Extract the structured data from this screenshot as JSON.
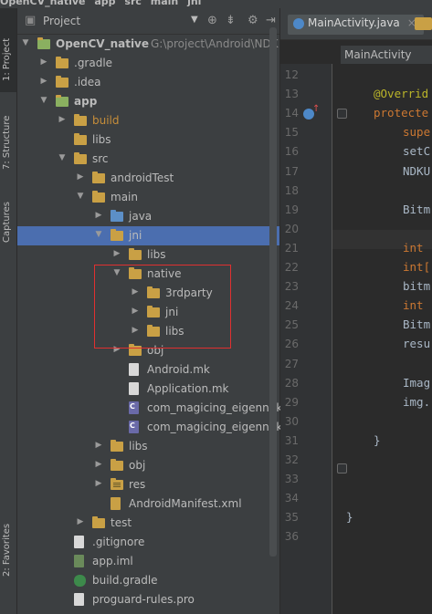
{
  "breadcrumb": [
    "OpenCV_native",
    "app",
    "src",
    "main",
    "jni"
  ],
  "side_tabs": [
    "1: Project",
    "7: Structure",
    "Captures",
    "2: Favorites"
  ],
  "project_panel": {
    "title": "Project",
    "tree": [
      {
        "label": "OpenCV_native",
        "path": "G:\\project\\Android\\NDK",
        "depth": 0,
        "expanded": true,
        "icon": "module",
        "bold": true
      },
      {
        "label": ".gradle",
        "depth": 1,
        "expanded": false,
        "icon": "folder"
      },
      {
        "label": ".idea",
        "depth": 1,
        "expanded": false,
        "icon": "folder"
      },
      {
        "label": "app",
        "depth": 1,
        "expanded": true,
        "icon": "module",
        "bold": true
      },
      {
        "label": "build",
        "depth": 2,
        "expanded": false,
        "icon": "folder"
      },
      {
        "label": "libs",
        "depth": 2,
        "icon": "folder"
      },
      {
        "label": "src",
        "depth": 2,
        "expanded": true,
        "icon": "folder"
      },
      {
        "label": "androidTest",
        "depth": 3,
        "expanded": false,
        "icon": "folder"
      },
      {
        "label": "main",
        "depth": 3,
        "expanded": true,
        "icon": "folder"
      },
      {
        "label": "java",
        "depth": 4,
        "expanded": false,
        "icon": "folder-blue"
      },
      {
        "label": "jni",
        "depth": 4,
        "expanded": true,
        "icon": "folder",
        "selected": true
      },
      {
        "label": "libs",
        "depth": 5,
        "expanded": false,
        "icon": "folder"
      },
      {
        "label": "native",
        "depth": 5,
        "expanded": true,
        "icon": "folder"
      },
      {
        "label": "3rdparty",
        "depth": 6,
        "expanded": false,
        "icon": "folder"
      },
      {
        "label": "jni",
        "depth": 6,
        "expanded": false,
        "icon": "folder"
      },
      {
        "label": "libs",
        "depth": 6,
        "expanded": false,
        "icon": "folder"
      },
      {
        "label": "obj",
        "depth": 5,
        "expanded": false,
        "icon": "folder"
      },
      {
        "label": "Android.mk",
        "depth": 5,
        "icon": "file"
      },
      {
        "label": "Application.mk",
        "depth": 5,
        "icon": "file"
      },
      {
        "label": "com_magicing_eigenndk_",
        "depth": 5,
        "icon": "cpp"
      },
      {
        "label": "com_magicing_eigenndk_",
        "depth": 5,
        "icon": "cpp"
      },
      {
        "label": "libs",
        "depth": 4,
        "expanded": false,
        "icon": "folder"
      },
      {
        "label": "obj",
        "depth": 4,
        "expanded": false,
        "icon": "folder"
      },
      {
        "label": "res",
        "depth": 4,
        "expanded": false,
        "icon": "folder-res"
      },
      {
        "label": "AndroidManifest.xml",
        "depth": 4,
        "icon": "xml"
      },
      {
        "label": "test",
        "depth": 3,
        "expanded": false,
        "icon": "folder"
      },
      {
        "label": ".gitignore",
        "depth": 2,
        "icon": "file"
      },
      {
        "label": "app.iml",
        "depth": 2,
        "icon": "file-module"
      },
      {
        "label": "build.gradle",
        "depth": 2,
        "icon": "gradle"
      },
      {
        "label": "proguard-rules.pro",
        "depth": 2,
        "icon": "file"
      }
    ]
  },
  "editor": {
    "tab_label": "MainActivity.java",
    "tab_close": "×",
    "method_bar": "MainActivity",
    "line_numbers": [
      "12",
      "13",
      "14",
      "15",
      "16",
      "17",
      "18",
      "19",
      "20",
      "21",
      "22",
      "23",
      "24",
      "25",
      "26",
      "27",
      "28",
      "29",
      "30",
      "31",
      "32",
      "33",
      "34",
      "35",
      "36"
    ],
    "code": [
      {
        "line": 12,
        "text": ""
      },
      {
        "line": 13,
        "text": "@Overrid",
        "cls": "ann",
        "indent": 1
      },
      {
        "line": 14,
        "text": "protecte",
        "cls": "kw",
        "indent": 1
      },
      {
        "line": 15,
        "text": "supe",
        "cls": "kw",
        "indent": 2
      },
      {
        "line": 16,
        "text": "setC",
        "indent": 2
      },
      {
        "line": 17,
        "text": "NDKU",
        "indent": 2
      },
      {
        "line": 18,
        "text": ""
      },
      {
        "line": 19,
        "text": "Bitm",
        "indent": 2
      },
      {
        "line": 20,
        "text": ""
      },
      {
        "line": 21,
        "text": "int ",
        "cls": "kw",
        "indent": 2
      },
      {
        "line": 22,
        "text": "int[",
        "cls": "kw",
        "indent": 2
      },
      {
        "line": 23,
        "text": "bitm",
        "indent": 2
      },
      {
        "line": 24,
        "text": "int ",
        "cls": "kw",
        "indent": 2
      },
      {
        "line": 25,
        "text": "Bitm",
        "indent": 2
      },
      {
        "line": 26,
        "text": "resu",
        "indent": 2
      },
      {
        "line": 27,
        "text": ""
      },
      {
        "line": 28,
        "text": "Imag",
        "indent": 2
      },
      {
        "line": 29,
        "text": "img.",
        "indent": 2
      },
      {
        "line": 30,
        "text": ""
      },
      {
        "line": 31,
        "text": "}",
        "indent": 1
      },
      {
        "line": 32,
        "text": ""
      },
      {
        "line": 33,
        "text": ""
      },
      {
        "line": 34,
        "text": ""
      },
      {
        "line": 35,
        "text": "}",
        "indent": 0
      },
      {
        "line": 36,
        "text": ""
      }
    ]
  }
}
